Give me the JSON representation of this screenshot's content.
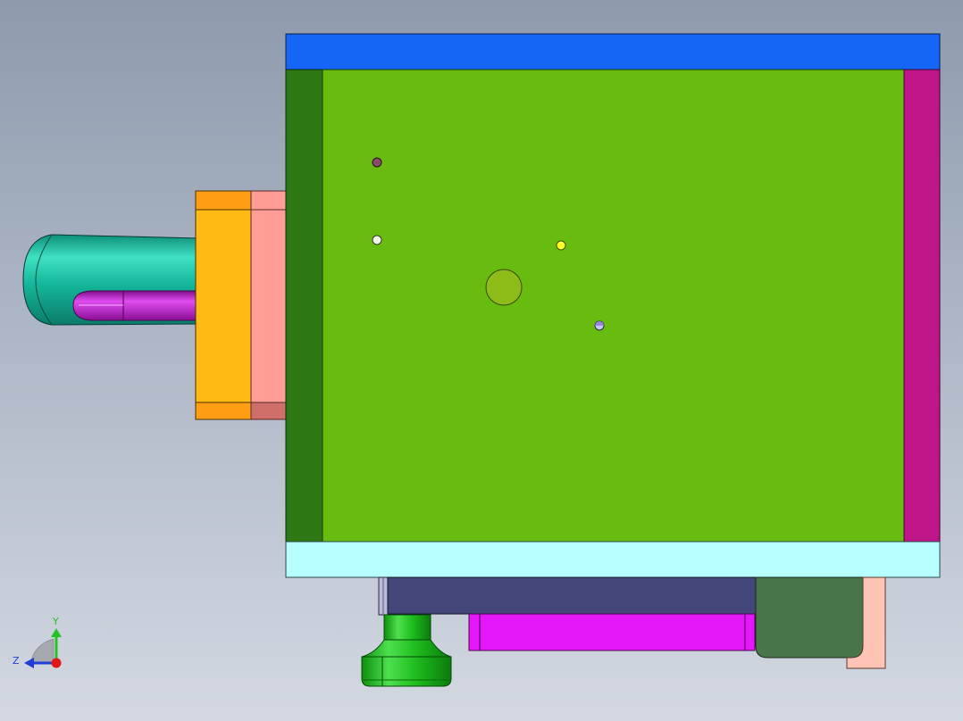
{
  "viewport": {
    "background_top": "#8e9bad",
    "background_bottom": "#d3d8e1"
  },
  "triad": {
    "y_label": "Y",
    "z_label": "Z",
    "y_color": "#22c322",
    "z_color": "#1f3fd6",
    "x_color": "#e01818"
  },
  "colors": {
    "top_plate": "#1565f7",
    "green_plate": "#68bc10",
    "left_strip": "#2e7813",
    "right_strip": "#be1589",
    "bottom_plate": "#b8ffff",
    "orange_block": "#ffbb14",
    "pink_block": "#ff9d96",
    "cylinder": "#14b79b",
    "magenta_rod": "#b312bf",
    "dark_block": "#434679",
    "purple_bar": "#e317f7",
    "dark_green_block": "#487549",
    "knob": "#1fbe1f",
    "salmon_bar": "#ffc4b6",
    "center_circle": "#8dbb17"
  },
  "icons": {
    "triad": "coordinate-triad-icon"
  }
}
